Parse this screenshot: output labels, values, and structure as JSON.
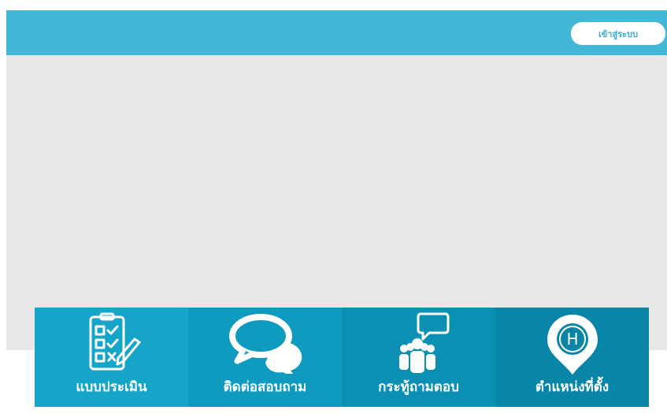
{
  "header": {
    "login_label": "เข้าสู่ระบบ",
    "bg_color": "#42b8d6"
  },
  "hero": {
    "bg_color": "#e8e8e8"
  },
  "tiles": [
    {
      "label": "แบบประเมิน",
      "icon": "checklist-clipboard-icon",
      "color": "#14a5c8"
    },
    {
      "label": "ติดต่อสอบถาม",
      "icon": "speech-bubbles-icon",
      "color": "#0e9bbf"
    },
    {
      "label": "กระทู้ถามตอบ",
      "icon": "group-chat-icon",
      "color": "#0b90b4"
    },
    {
      "label": "ตำแหน่งที่ตั้ง",
      "icon": "location-pin-icon",
      "color": "#0985a8"
    }
  ],
  "icons": {
    "location_pin_letter": "H"
  }
}
